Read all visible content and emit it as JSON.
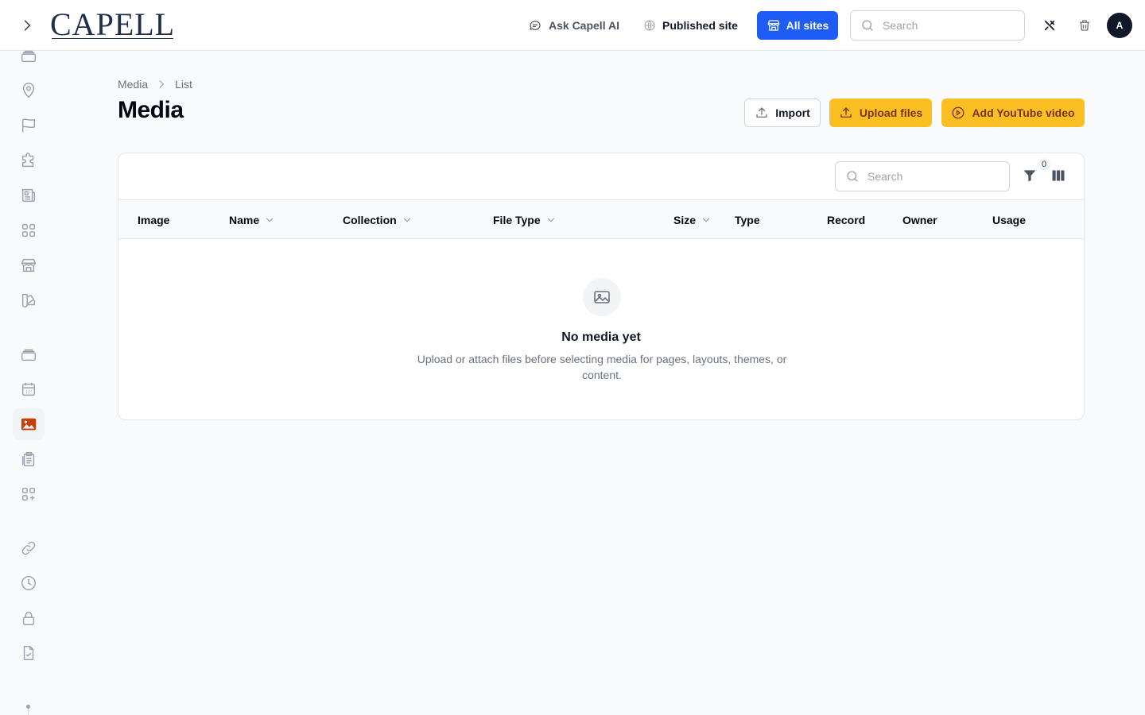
{
  "topbar": {
    "logo_text": "CAPELL",
    "ask_ai_label": "Ask Capell AI",
    "published_site_label": "Published site",
    "all_sites_label": "All sites",
    "search_placeholder": "Search",
    "avatar_initial": "A"
  },
  "sidebar": {
    "items": [
      {
        "icon": "stack-icon"
      },
      {
        "icon": "map-pin-icon"
      },
      {
        "icon": "flag-icon"
      },
      {
        "icon": "puzzle-icon"
      },
      {
        "icon": "newspaper-icon"
      },
      {
        "icon": "grid-icon"
      },
      {
        "icon": "storefront-icon"
      },
      {
        "icon": "swatch-icon"
      },
      {
        "icon": "stack-icon"
      },
      {
        "icon": "calendar-icon"
      },
      {
        "icon": "photo-icon",
        "active": true
      },
      {
        "icon": "clipboard-icon"
      },
      {
        "icon": "grid-plus-icon"
      },
      {
        "icon": "link-icon"
      },
      {
        "icon": "clock-icon"
      },
      {
        "icon": "lock-icon"
      },
      {
        "icon": "document-check-icon"
      }
    ],
    "active_color": "#c2410c"
  },
  "breadcrumb": {
    "items": [
      "Media",
      "List"
    ]
  },
  "page": {
    "title": "Media",
    "import_label": "Import",
    "upload_label": "Upload files",
    "youtube_label": "Add YouTube video"
  },
  "table": {
    "search_placeholder": "Search",
    "filter_count": "0",
    "columns": [
      {
        "label": "Image",
        "sortable": false
      },
      {
        "label": "Name",
        "sortable": true
      },
      {
        "label": "Collection",
        "sortable": true
      },
      {
        "label": "File Type",
        "sortable": true
      },
      {
        "label": "Size",
        "sortable": true
      },
      {
        "label": "Type",
        "sortable": false
      },
      {
        "label": "Record",
        "sortable": false
      },
      {
        "label": "Owner",
        "sortable": false
      },
      {
        "label": "Usage",
        "sortable": false
      }
    ],
    "rows": [],
    "empty_title": "No media yet",
    "empty_description": "Upload or attach files before selecting media for pages, layouts, themes, or content."
  },
  "colors": {
    "primary": "#1d5cf5",
    "accent": "#fbbf24",
    "accent_text": "#78350f"
  }
}
